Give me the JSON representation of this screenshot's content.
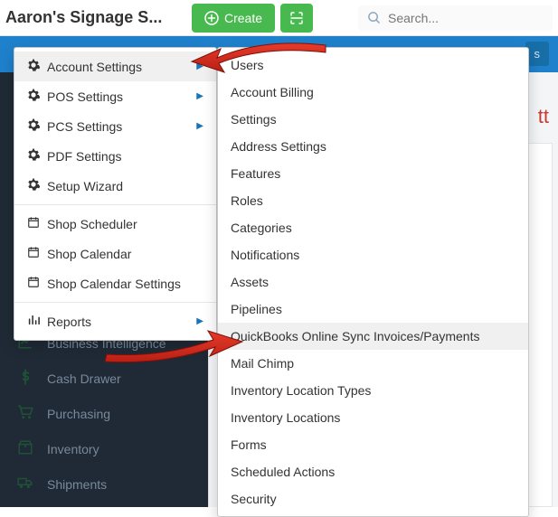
{
  "topbar": {
    "brand": "Aaron's Signage S...",
    "create": "Create",
    "search_placeholder": "Search..."
  },
  "blue": {
    "pill": "s"
  },
  "page": {
    "title": "tt"
  },
  "dark_items": [
    {
      "icon": "chart-bar",
      "label": "Business Intelligence"
    },
    {
      "icon": "dollar",
      "label": "Cash Drawer"
    },
    {
      "icon": "cart",
      "label": "Purchasing"
    },
    {
      "icon": "box",
      "label": "Inventory"
    },
    {
      "icon": "truck",
      "label": "Shipments"
    }
  ],
  "dropdown": [
    {
      "icon": "gear",
      "label": "Account Settings",
      "submenu": true,
      "hover": true
    },
    {
      "icon": "gear",
      "label": "POS Settings",
      "submenu": true
    },
    {
      "icon": "gear",
      "label": "PCS Settings",
      "submenu": true
    },
    {
      "icon": "gear",
      "label": "PDF Settings"
    },
    {
      "icon": "gear",
      "label": "Setup Wizard"
    },
    {
      "sep": true
    },
    {
      "icon": "calendar",
      "label": "Shop Scheduler"
    },
    {
      "icon": "calendar",
      "label": "Shop Calendar"
    },
    {
      "icon": "calendar",
      "label": "Shop Calendar Settings"
    },
    {
      "sep": true
    },
    {
      "icon": "bars",
      "label": "Reports",
      "submenu": true
    }
  ],
  "submenu": [
    {
      "label": "Users"
    },
    {
      "label": "Account Billing"
    },
    {
      "label": "Settings"
    },
    {
      "label": "Address Settings"
    },
    {
      "label": "Features"
    },
    {
      "label": "Roles"
    },
    {
      "label": "Categories"
    },
    {
      "label": "Notifications"
    },
    {
      "label": "Assets"
    },
    {
      "label": "Pipelines"
    },
    {
      "label": "QuickBooks Online Sync Invoices/Payments",
      "hover": true
    },
    {
      "label": "Mail Chimp"
    },
    {
      "label": "Inventory Location Types"
    },
    {
      "label": "Inventory Locations"
    },
    {
      "label": "Forms"
    },
    {
      "label": "Scheduled Actions"
    },
    {
      "label": "Security"
    }
  ]
}
